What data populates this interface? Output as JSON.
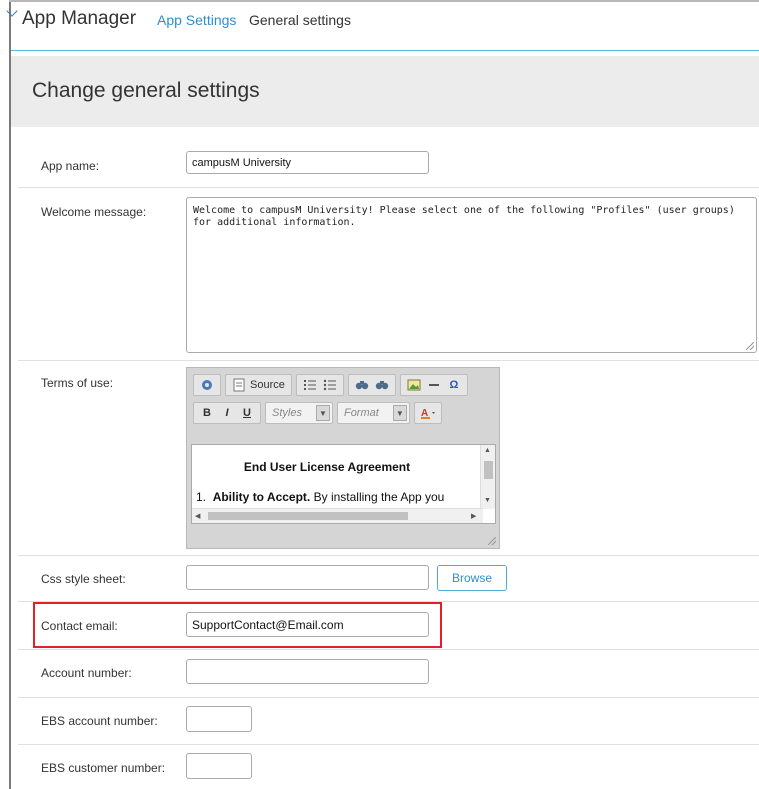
{
  "header": {
    "app_title": "App Manager",
    "breadcrumb_link": "App Settings",
    "breadcrumb_current": "General settings"
  },
  "page": {
    "title": "Change general settings"
  },
  "form": {
    "app_name": {
      "label": "App name:",
      "value": "campusM University"
    },
    "welcome_message": {
      "label": "Welcome message:",
      "value": "Welcome to campusM University! Please select one of the following \"Profiles\" (user groups) for additional information."
    },
    "terms_of_use": {
      "label": "Terms of use:",
      "toolbar": {
        "source_label": "Source",
        "bold": "B",
        "italic": "I",
        "underline": "U",
        "styles_placeholder": "Styles",
        "format_placeholder": "Format",
        "special_char": "Ω"
      },
      "content_title": "End User License Agreement",
      "content_line_number": "1.",
      "content_line_bold": "Ability to Accept.",
      "content_line_rest": " By installing the App you"
    },
    "css_style_sheet": {
      "label": "Css style sheet:",
      "value": "",
      "browse_label": "Browse"
    },
    "contact_email": {
      "label": "Contact email:",
      "value": "SupportContact@Email.com"
    },
    "account_number": {
      "label": "Account number:",
      "value": ""
    },
    "ebs_account_number": {
      "label": "EBS account number:",
      "value": ""
    },
    "ebs_customer_number": {
      "label": "EBS customer number:",
      "value": ""
    }
  },
  "colors": {
    "accent_blue": "#2c8fd1",
    "highlight_red": "#e0202b",
    "header_panel": "#ececec"
  }
}
